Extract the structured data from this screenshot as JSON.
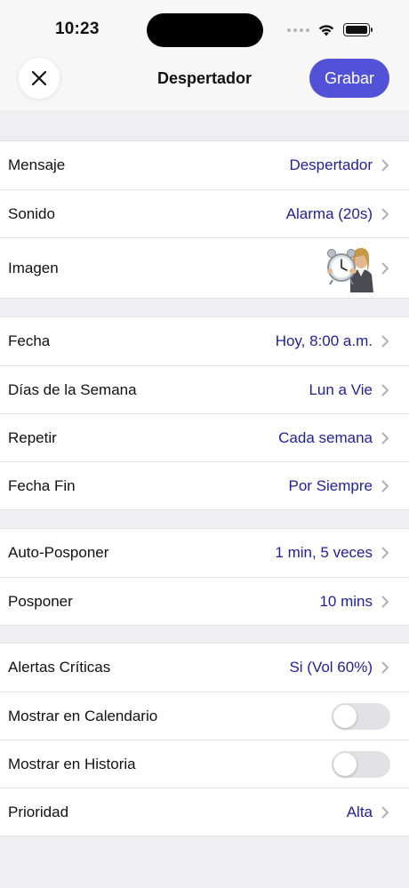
{
  "status_bar": {
    "time": "10:23"
  },
  "nav": {
    "title": "Despertador",
    "record_label": "Grabar"
  },
  "sections": {
    "general": {
      "message": {
        "label": "Mensaje",
        "value": "Despertador"
      },
      "sound": {
        "label": "Sonido",
        "value": "Alarma (20s)"
      },
      "image": {
        "label": "Imagen"
      }
    },
    "schedule": {
      "date": {
        "label": "Fecha",
        "value": "Hoy, 8:00 a.m."
      },
      "weekdays": {
        "label": "Días de la Semana",
        "value": "Lun a Vie"
      },
      "repeat": {
        "label": "Repetir",
        "value": "Cada semana"
      },
      "end_date": {
        "label": "Fecha Fin",
        "value": "Por Siempre"
      }
    },
    "snooze": {
      "auto_snooze": {
        "label": "Auto-Posponer",
        "value": "1 min, 5 veces"
      },
      "snooze": {
        "label": "Posponer",
        "value": "10 mins"
      }
    },
    "options": {
      "critical_alerts": {
        "label": "Alertas Críticas",
        "value": "Si (Vol 60%)"
      },
      "show_calendar": {
        "label": "Mostrar en Calendario",
        "enabled": false
      },
      "show_history": {
        "label": "Mostrar en Historia",
        "enabled": false
      },
      "priority": {
        "label": "Prioridad",
        "value": "Alta"
      }
    }
  },
  "colors": {
    "accent": "#5252d8",
    "value_text": "#1f1f9e",
    "background": "#efeff3"
  }
}
